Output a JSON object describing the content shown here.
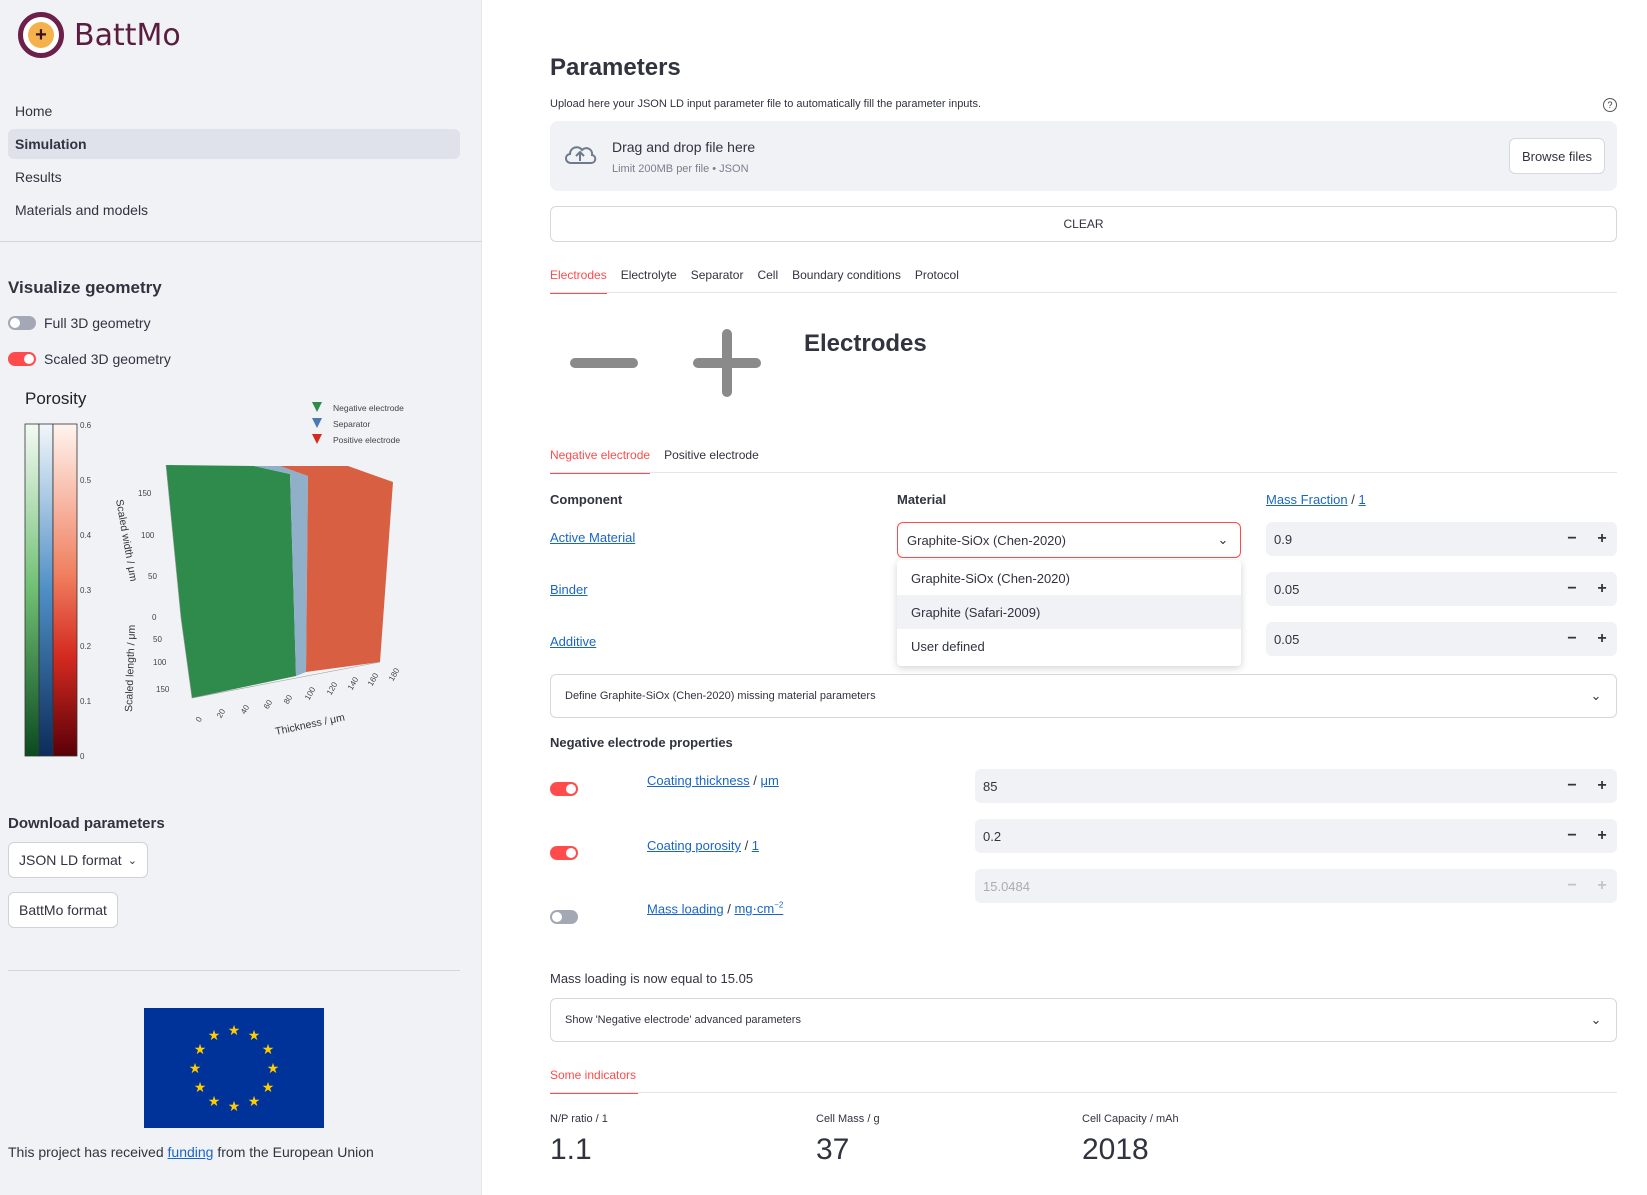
{
  "app": {
    "name": "BattMo"
  },
  "sidebar": {
    "nav": [
      "Home",
      "Simulation",
      "Results",
      "Materials and models"
    ],
    "visualize_title": "Visualize geometry",
    "toggles": [
      {
        "label": "Full 3D geometry",
        "on": false
      },
      {
        "label": "Scaled 3D geometry",
        "on": true
      }
    ],
    "download_title": "Download parameters",
    "json_ld_button": "JSON LD format",
    "battmo_button": "BattMo format",
    "funding_prefix": "This project has received ",
    "funding_link": "funding",
    "funding_suffix": " from the European Union"
  },
  "plot": {
    "colorbar_title": "Porosity",
    "colorbar_ticks": [
      "0.6",
      "0.5",
      "0.4",
      "0.3",
      "0.2",
      "0.1",
      "0"
    ],
    "legend": [
      "Negative electrode",
      "Separator",
      "Positive electrode"
    ],
    "width_axis_label": "Scaled width / μm",
    "width_ticks": [
      "150",
      "100",
      "50",
      "0"
    ],
    "length_axis_label": "Scaled length / μm",
    "length_ticks": [
      "50",
      "100",
      "150"
    ],
    "thickness_axis_label": "Thickness / μm",
    "thickness_ticks": [
      "0",
      "20",
      "40",
      "60",
      "80",
      "100",
      "120",
      "140",
      "160",
      "180"
    ],
    "colors": {
      "negative": "#2e8b4b",
      "separator": "#8fb0c8",
      "positive": "#d95f43"
    }
  },
  "main": {
    "title": "Parameters",
    "upload_hint": "Upload here your JSON LD input parameter file to automatically fill the parameter inputs.",
    "drag_text": "Drag and drop file here",
    "limit_text": "Limit 200MB per file • JSON",
    "browse_button": "Browse files",
    "clear_button": "CLEAR",
    "tabs": [
      "Electrodes",
      "Electrolyte",
      "Separator",
      "Cell",
      "Boundary conditions",
      "Protocol"
    ],
    "section_title": "Electrodes",
    "subtabs": [
      "Negative electrode",
      "Positive electrode"
    ],
    "columns": {
      "component": "Component",
      "material": "Material",
      "mass_fraction": "Mass Fraction",
      "mass_fraction_unit": "1"
    },
    "components": [
      {
        "name": "Active Material",
        "mass_fraction": "0.9"
      },
      {
        "name": "Binder",
        "mass_fraction": "0.05"
      },
      {
        "name": "Additive",
        "mass_fraction": "0.05"
      }
    ],
    "material_select_value": "Graphite-SiOx (Chen-2020)",
    "material_options": [
      "Graphite-SiOx (Chen-2020)",
      "Graphite (Safari-2009)",
      "User defined"
    ],
    "missing_params_expander": "Define Graphite-SiOx (Chen-2020) missing material parameters",
    "properties_title": "Negative electrode properties",
    "properties": [
      {
        "name": "Coating thickness",
        "unit": "μm",
        "value": "85",
        "on": true
      },
      {
        "name": "Coating porosity",
        "unit": "1",
        "value": "0.2",
        "on": true
      },
      {
        "name": "Mass loading",
        "unit": "mg·cm",
        "unit_sup": "−2",
        "value": "15.0484",
        "on": false
      }
    ],
    "mass_loading_note": "Mass loading is now equal to 15.05",
    "advanced_expander": "Show 'Negative electrode' advanced parameters",
    "indicators_tab": "Some indicators",
    "indicators": [
      {
        "label": "N/P ratio / 1",
        "value": "1.1"
      },
      {
        "label": "Cell Mass / g",
        "value": "37"
      },
      {
        "label": "Cell Capacity / mAh",
        "value": "2018"
      }
    ]
  }
}
